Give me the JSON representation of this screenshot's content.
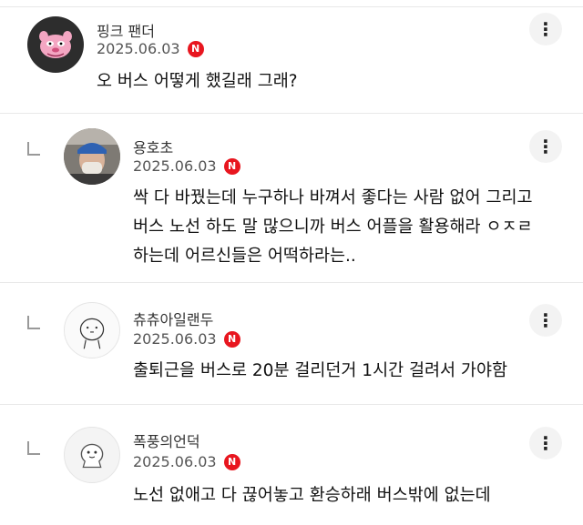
{
  "comments": [
    {
      "name": "핑크 팬더",
      "date": "2025.06.03",
      "badge": "N",
      "text": [
        "오 버스 어떻게 했길래 그래?"
      ],
      "avatar": "pink-panther-avatar"
    },
    {
      "name": "용호초",
      "date": "2025.06.03",
      "badge": "N",
      "text": [
        "싹 다 바꿨는데 누구하나 바껴서 좋다는 사람 없어 그리고",
        "버스 노선 하도 말 많으니까 버스 어플을 활용해라 ㅇㅈㄹ",
        "하는데 어르신들은 어떡하라는.."
      ],
      "avatar": "photo-avatar"
    },
    {
      "name": "츄츄아일랜두",
      "date": "2025.06.03",
      "badge": "N",
      "text": [
        "출퇴근을 버스로 20분 걸리던거 1시간 걸려서 가야함"
      ],
      "avatar": "doodle-avatar"
    },
    {
      "name": "폭풍의언덕",
      "date": "2025.06.03",
      "badge": "N",
      "text": [
        "노선 없애고 다 끊어놓고 환승하래 버스밖에 없는데"
      ],
      "avatar": "character-avatar"
    }
  ],
  "more_icon": "⋮",
  "colors": {
    "badge": "#e8161f",
    "divider": "#e9e9e9"
  }
}
